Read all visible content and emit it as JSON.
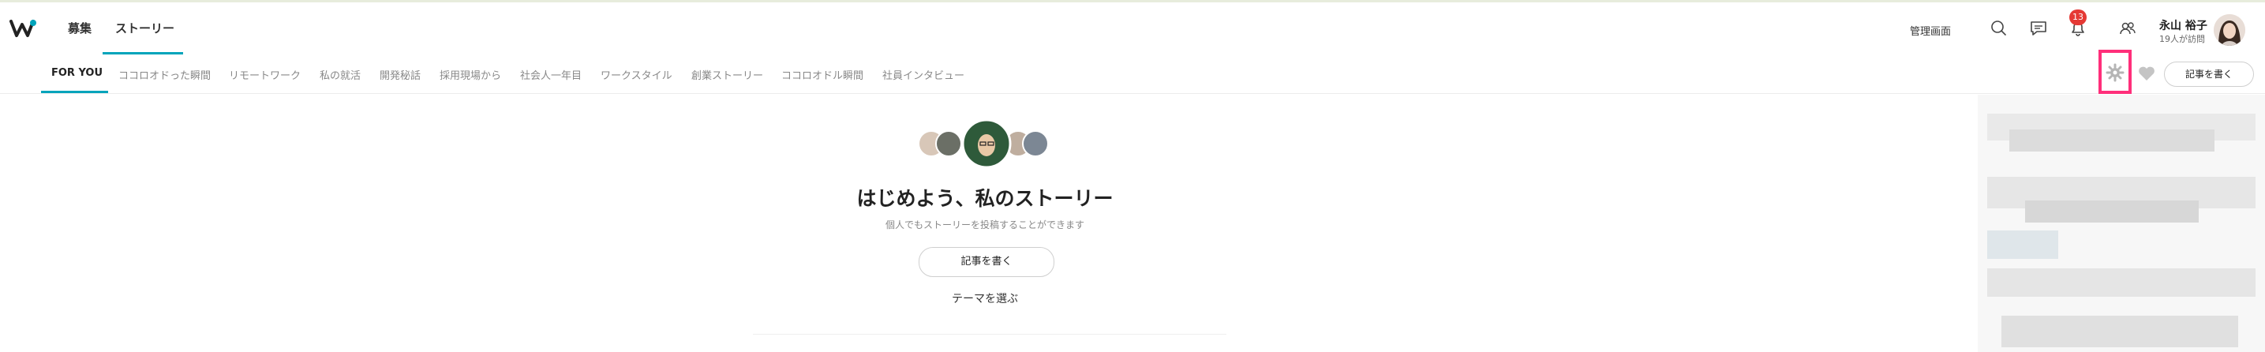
{
  "header": {
    "nav": [
      {
        "label": "募集"
      },
      {
        "label": "ストーリー"
      }
    ],
    "admin_label": "管理画面",
    "notification_count": "13",
    "user": {
      "name": "永山 裕子",
      "subtitle": "19人が訪問"
    },
    "icons": [
      "search-icon",
      "message-icon",
      "bell-icon",
      "people-icon"
    ]
  },
  "subnav": {
    "categories": [
      {
        "label": "FOR YOU"
      },
      {
        "label": "ココロオドった瞬間"
      },
      {
        "label": "リモートワーク"
      },
      {
        "label": "私の就活"
      },
      {
        "label": "開発秘話"
      },
      {
        "label": "採用現場から"
      },
      {
        "label": "社会人一年目"
      },
      {
        "label": "ワークスタイル"
      },
      {
        "label": "創業ストーリー"
      },
      {
        "label": "ココロオドル瞬間"
      },
      {
        "label": "社員インタビュー"
      }
    ],
    "active_index": 0,
    "write_label": "記事を書く",
    "icons": [
      "gear-icon",
      "heart-icon"
    ]
  },
  "main": {
    "headline": "はじめよう、私のストーリー",
    "subline": "個人でもストーリーを投稿することができます",
    "write_button": "記事を書く",
    "theme_link": "テーマを選ぶ"
  },
  "colors": {
    "accent": "#00a4bb",
    "highlight": "#ff2f7a",
    "badge": "#e53935"
  }
}
